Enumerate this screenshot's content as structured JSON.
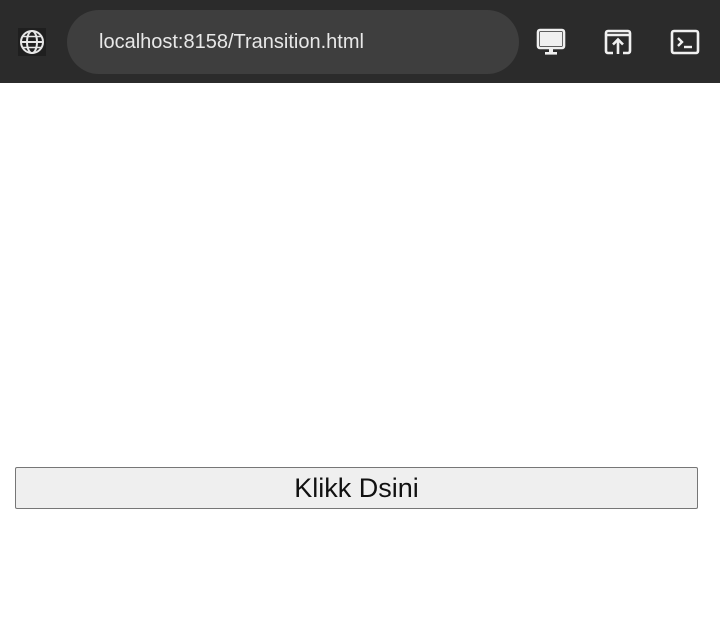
{
  "browser": {
    "url": "localhost:8158/Transition.html",
    "icons": {
      "site_info": "globe-icon",
      "desktop_mode": "monitor-icon",
      "open_external": "open-in-browser-icon",
      "console": "terminal-icon"
    },
    "colors": {
      "toolbar": "#2b2b2b",
      "url_pill": "#3e3e3e",
      "url_text": "#e8e8e8"
    }
  },
  "page": {
    "button_label": "Klikk Dsini",
    "colors": {
      "background": "#ffffff",
      "button_bg": "#efefef",
      "button_border": "#767676"
    }
  }
}
